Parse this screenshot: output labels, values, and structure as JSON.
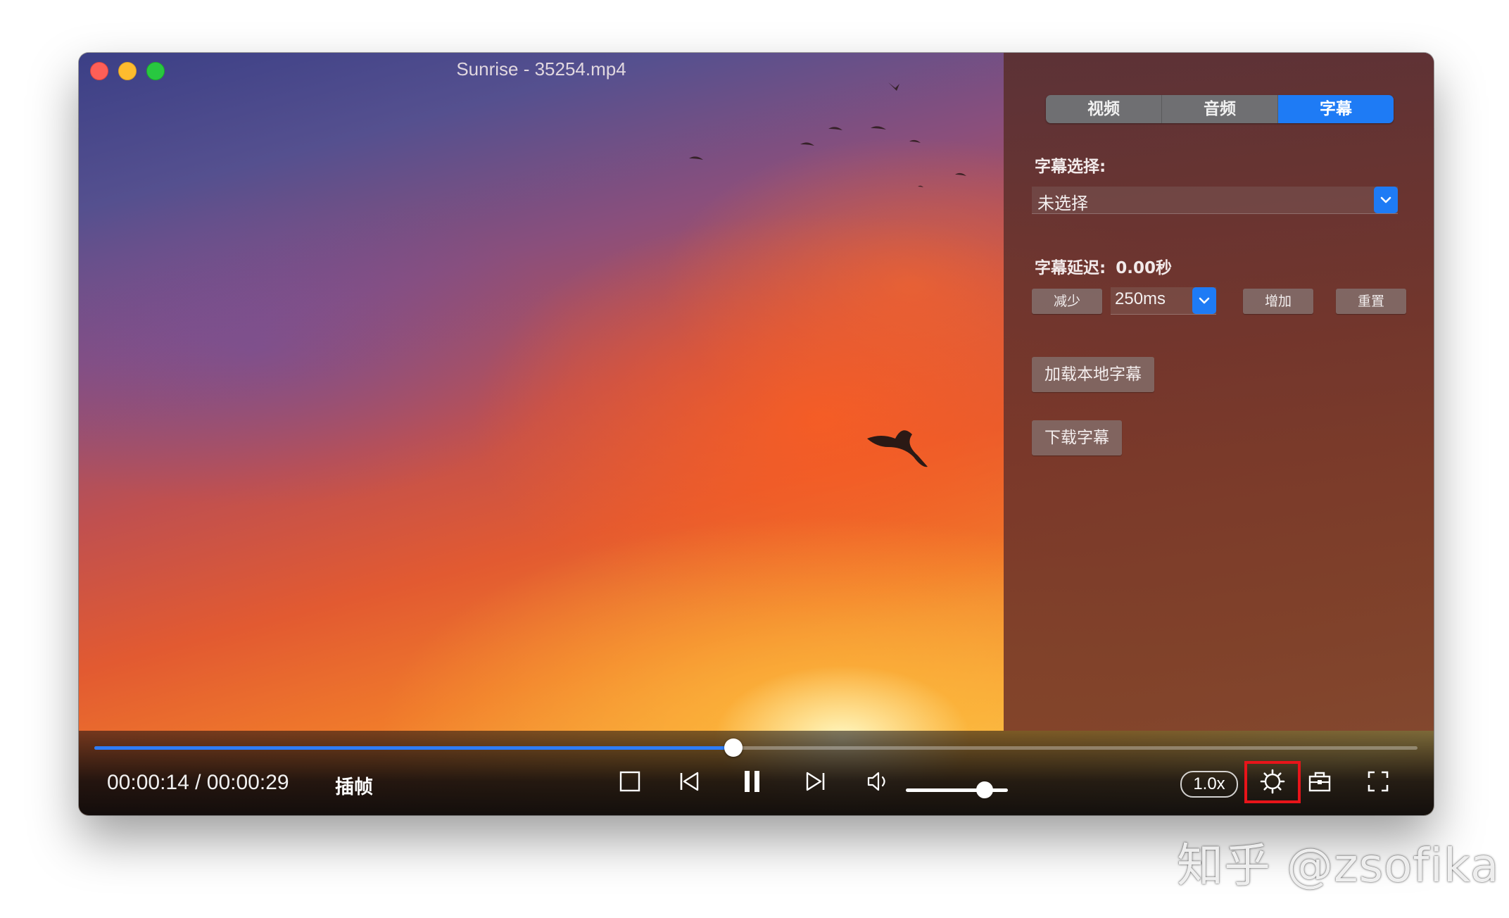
{
  "window": {
    "title": "Sunrise - 35254.mp4"
  },
  "panel": {
    "tabs": [
      {
        "label": "视频",
        "active": false
      },
      {
        "label": "音频",
        "active": false
      },
      {
        "label": "字幕",
        "active": true
      }
    ],
    "subtitle_select_label": "字幕选择:",
    "subtitle_select_value": "未选择",
    "subtitle_delay_label": "字幕延迟:",
    "subtitle_delay_value": "0.00秒",
    "decrease_label": "减少",
    "step_value": "250ms",
    "increase_label": "增加",
    "reset_label": "重置",
    "load_local_label": "加载本地字幕",
    "download_label": "下载字幕"
  },
  "controls": {
    "time_display": "00:00:14 / 00:00:29",
    "frame_interp_label": "插帧",
    "progress_percent": 48.3,
    "volume_percent": 77,
    "speed_label": "1.0x"
  },
  "colors": {
    "accent": "#1e7bf5",
    "highlight": "#e8141a"
  },
  "watermark": "知乎 @zsofika"
}
